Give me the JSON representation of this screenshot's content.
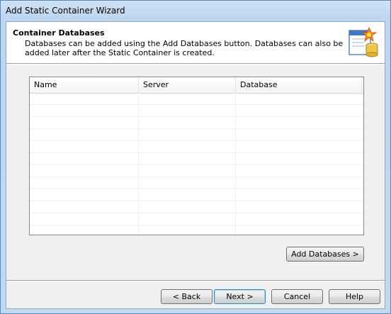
{
  "window": {
    "title": "Add Static Container Wizard"
  },
  "header": {
    "title": "Container Databases",
    "description": "Databases can be added using the Add Databases button. Databases can also be added later after the Static Container is created."
  },
  "table": {
    "columns": [
      "Name",
      "Server",
      "Database"
    ],
    "rows": []
  },
  "buttons": {
    "add_databases": "Add Databases  >",
    "back": "< Back",
    "next": "Next >",
    "cancel": "Cancel",
    "help": "Help"
  },
  "icons": {
    "header": "wizard-database-star-icon"
  }
}
